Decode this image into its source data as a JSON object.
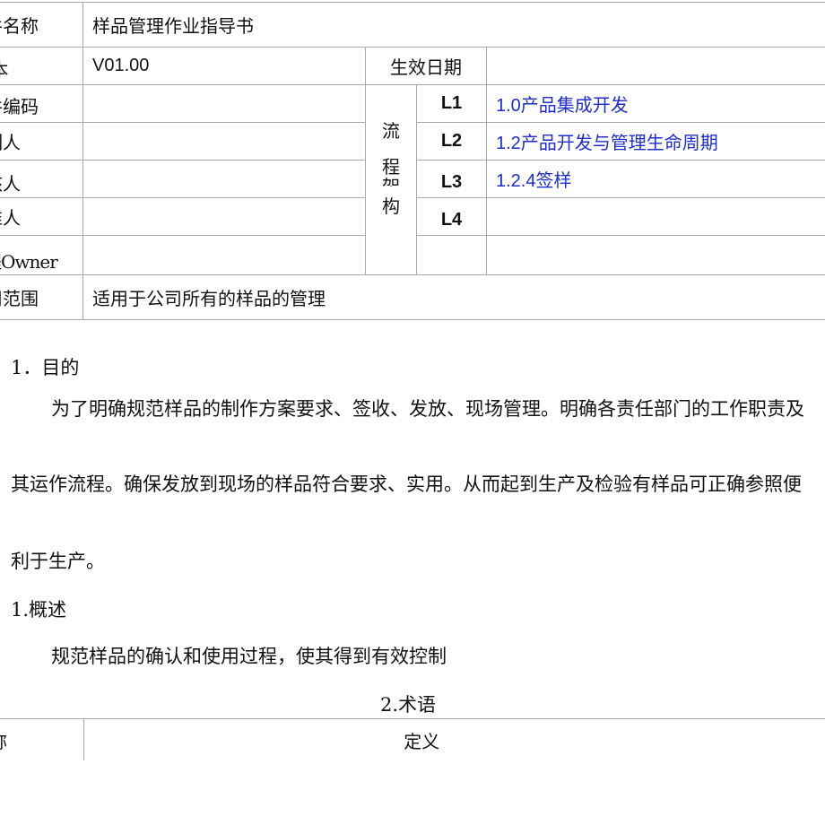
{
  "header": {
    "doc_name_label": "文件名称",
    "doc_name_value": "样品管理作业指导书",
    "version_label": "版  本",
    "version_value": "V01.00",
    "effective_date_label": "生效日期",
    "effective_date_value": "",
    "doc_number_label": "文件编码",
    "preparer_label": "编制人",
    "reviewer_label": "审核人",
    "approver_label": "批准人",
    "owner_label": "流程Owner",
    "scope_label": "适用范围",
    "scope_value": "适用于公司所有的样品的管理",
    "process_arch_chars": [
      "流",
      "程",
      "架",
      "构"
    ],
    "levels": [
      {
        "code": "L1",
        "value": "1.0产品集成开发"
      },
      {
        "code": "L2",
        "value": "1.2产品开发与管理生命周期"
      },
      {
        "code": "L3",
        "value": "1.2.4签样"
      },
      {
        "code": "L4",
        "value": ""
      },
      {
        "code": "",
        "value": ""
      }
    ],
    "link_color": "#1f2fc8"
  },
  "body": {
    "section1_heading": "1．目的",
    "section1_para_line1": "为了明确规范样品的制作方案要求、签收、发放、现场管理。明确各责任部门的工作职责及",
    "section1_para_line2": "其运作流程。确保发放到现场的样品符合要求、实用。从而起到生产及检验有样品可正确参照便",
    "section1_para_line3": "利于生产。",
    "section2_heading": "1.概述",
    "section2_text": "规范样品的确认和使用过程，使其得到有效控制",
    "section3_heading": "2.术语"
  },
  "terms_table": {
    "col_name": "名称",
    "col_definition": "定义"
  }
}
